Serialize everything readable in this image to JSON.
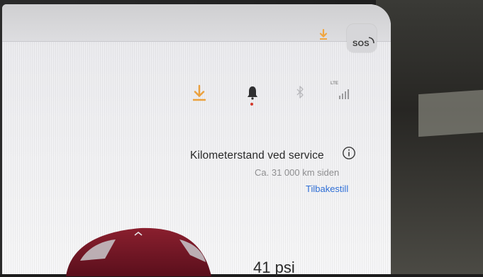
{
  "topbar": {
    "download_icon": "download-icon",
    "sos_label": "SOS",
    "accent_color": "#f0a640"
  },
  "status_bar": {
    "download_icon": "download-icon",
    "bell_icon": "bell-icon",
    "bluetooth_icon": "bluetooth-icon",
    "signal_icon": "signal-icon",
    "signal_label": "LTE",
    "alert_dot_color": "#d43a2c"
  },
  "service": {
    "title": "Kilometerstand ved service",
    "subtitle": "Ca. 31 000 km siden",
    "reset_label": "Tilbakestill",
    "link_color": "#2f6fd6"
  },
  "tire": {
    "pressure": "41 psi"
  }
}
